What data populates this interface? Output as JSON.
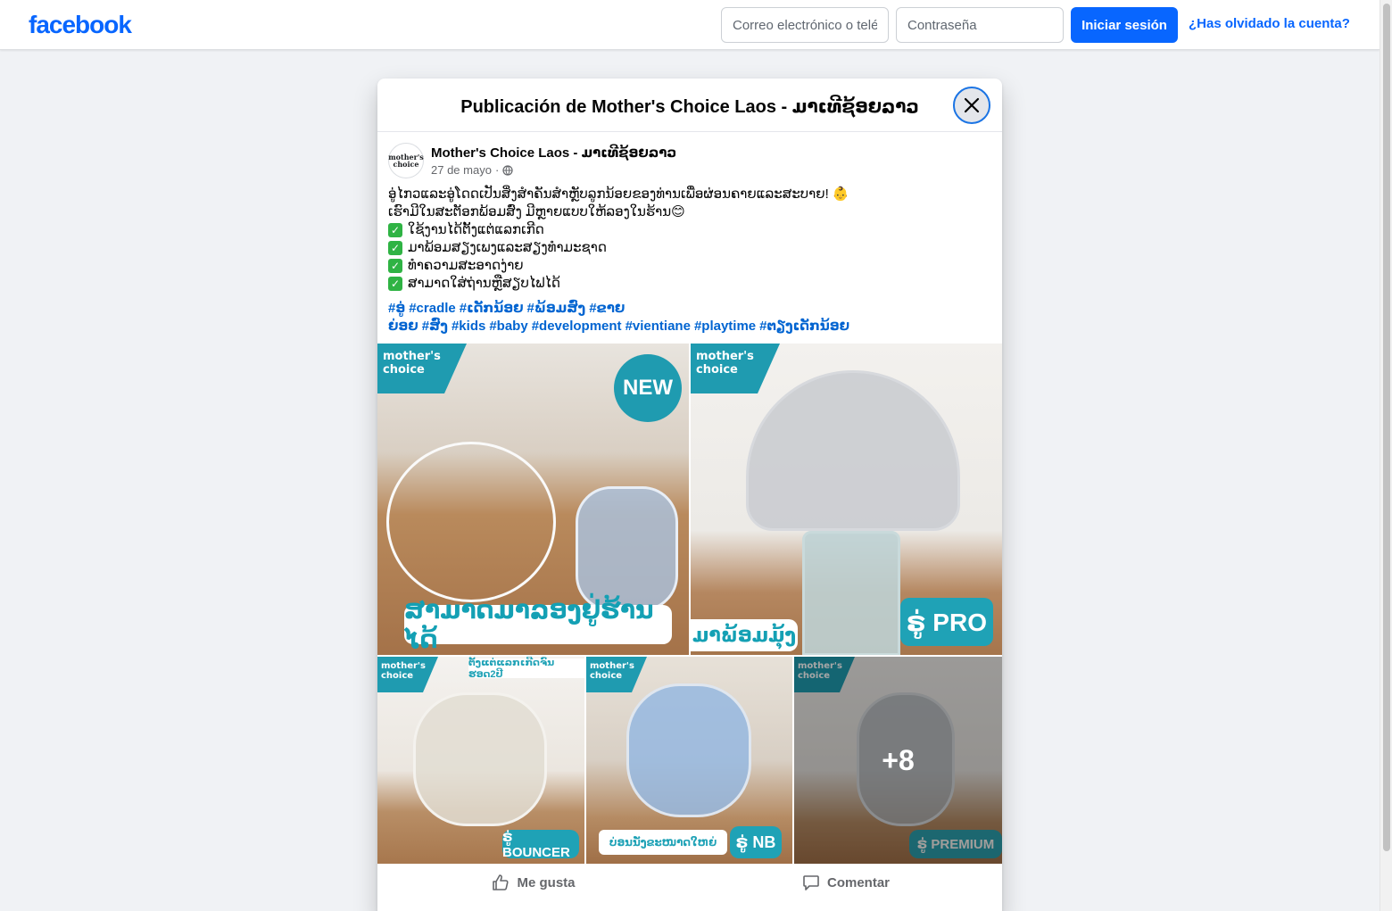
{
  "header": {
    "logo_text": "facebook",
    "email_placeholder": "Correo electrónico o teléfono",
    "password_placeholder": "Contraseña",
    "login_label": "Iniciar sesión",
    "forgot_label": "¿Has olvidado la cuenta?"
  },
  "modal": {
    "title": "Publicación de Mother's Choice Laos - ມາເທີຊ້ອຍລາວ",
    "close_icon": "close-icon"
  },
  "post": {
    "avatar_line1": "mother's",
    "avatar_line2": "choice",
    "page_name": "Mother's Choice Laos - ມາເທີຊ້ອຍລາວ",
    "date": "27 de mayo",
    "separator": "·",
    "privacy_icon": "globe-icon",
    "text_lines": [
      "ອູ່ໄກວແລະອູ່ໂດດເປັນສິ່ງສຳຄັນສຳຫຼັບລູກນ້ອຍຂອງທ່ານເພື່ອຜ່ອນຄາຍແລະສະບາຍ! 👶",
      "ເຮົາມີໃນສະຕັອກພ້ອມສົ່ງ ມີຫຼາຍແບບໃຫ້ລອງໃນຮ້ານ😊"
    ],
    "checklist": [
      "ໃຊ້ງານໄດ້ຕັ້ງແຕ່ແລກເກີດ",
      "ມາພ້ອມສຽງເພງແລະສຽງທຳມະຊາດ",
      "ທຳຄວາມສະອາດງ່າຍ",
      "ສາມາດໃສ່ຖ່ານຫຼືສຽບໄຟໄດ້"
    ],
    "check_glyph": "✓",
    "hashtags": [
      "#ອູ່",
      "#cradle",
      "#ເດັກນ້ອຍ",
      "#ພ້ອມສົ່ງ",
      "#ຂາຍຍ່ອຍ",
      "#ສົ່ງ",
      "#kids",
      "#baby",
      "#development",
      "#vientiane",
      "#playtime",
      "#ຕຽງເດັກນ້ອຍ"
    ]
  },
  "photos": {
    "brand_line1": "mother's",
    "brand_line2": "choice",
    "p1_badge": "NEW",
    "p1_caption": "ສາມາດມາລອງຢູ່ຮ້ານໄດ້",
    "p2_caption": "ມາພ້ອມມຸ້ງ",
    "p2_model": "ຣູ່ PRO",
    "p3_strip": "ຕັ້ງແຕ່ແລກເກີດຈົນຮອດ2ປີ",
    "p3_model": "ຣູ່ BOUNCER",
    "p4_strip": "ບ່ອນນັ່ງຂະໜາດໃຫຍ່",
    "p4_model": "ຣູ່ NB",
    "p5_model": "ຣູ່ PREMIUM",
    "more_count": "+8"
  },
  "actions": {
    "like_label": "Me gusta",
    "like_icon": "thumbs-up-icon",
    "comment_label": "Comentar",
    "comment_icon": "comment-icon"
  },
  "colors": {
    "brand_blue": "#0866ff",
    "hashtag_blue": "#0064d1",
    "teal": "#1f9bb0"
  }
}
